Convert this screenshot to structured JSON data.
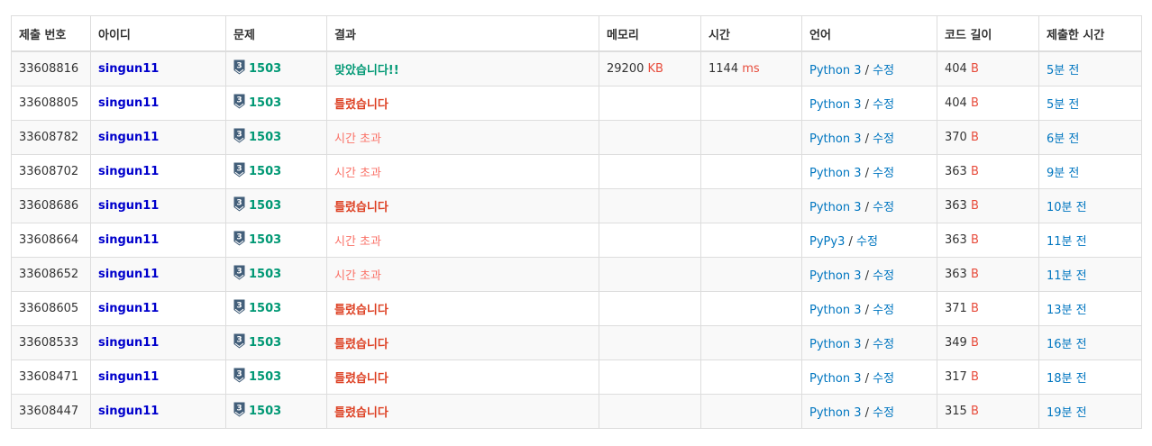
{
  "headers": [
    "제출 번호",
    "아이디",
    "문제",
    "결과",
    "메모리",
    "시간",
    "언어",
    "코드 길이",
    "제출한 시간"
  ],
  "units": {
    "memory": "KB",
    "time": "ms",
    "code_length": "B"
  },
  "edit_label": "수정",
  "tier_badge_label": "3",
  "colors": {
    "accepted": "#009874",
    "wrong_answer": "#dd4124",
    "time_limit": "#fa7268",
    "user": "#0000cc",
    "link": "#0076c0",
    "unit": "#e74c3c"
  },
  "rows": [
    {
      "id": "33608816",
      "user": "singun11",
      "problem": "1503",
      "result": "맞았습니다!!",
      "result_type": "ac",
      "memory": "29200",
      "time": "1144",
      "language": "Python 3",
      "code_length": "404",
      "submitted": "5분 전"
    },
    {
      "id": "33608805",
      "user": "singun11",
      "problem": "1503",
      "result": "틀렸습니다",
      "result_type": "wa",
      "memory": "",
      "time": "",
      "language": "Python 3",
      "code_length": "404",
      "submitted": "5분 전"
    },
    {
      "id": "33608782",
      "user": "singun11",
      "problem": "1503",
      "result": "시간 초과",
      "result_type": "tle",
      "memory": "",
      "time": "",
      "language": "Python 3",
      "code_length": "370",
      "submitted": "6분 전"
    },
    {
      "id": "33608702",
      "user": "singun11",
      "problem": "1503",
      "result": "시간 초과",
      "result_type": "tle",
      "memory": "",
      "time": "",
      "language": "Python 3",
      "code_length": "363",
      "submitted": "9분 전"
    },
    {
      "id": "33608686",
      "user": "singun11",
      "problem": "1503",
      "result": "틀렸습니다",
      "result_type": "wa",
      "memory": "",
      "time": "",
      "language": "Python 3",
      "code_length": "363",
      "submitted": "10분 전"
    },
    {
      "id": "33608664",
      "user": "singun11",
      "problem": "1503",
      "result": "시간 초과",
      "result_type": "tle",
      "memory": "",
      "time": "",
      "language": "PyPy3",
      "code_length": "363",
      "submitted": "11분 전"
    },
    {
      "id": "33608652",
      "user": "singun11",
      "problem": "1503",
      "result": "시간 초과",
      "result_type": "tle",
      "memory": "",
      "time": "",
      "language": "Python 3",
      "code_length": "363",
      "submitted": "11분 전"
    },
    {
      "id": "33608605",
      "user": "singun11",
      "problem": "1503",
      "result": "틀렸습니다",
      "result_type": "wa",
      "memory": "",
      "time": "",
      "language": "Python 3",
      "code_length": "371",
      "submitted": "13분 전"
    },
    {
      "id": "33608533",
      "user": "singun11",
      "problem": "1503",
      "result": "틀렸습니다",
      "result_type": "wa",
      "memory": "",
      "time": "",
      "language": "Python 3",
      "code_length": "349",
      "submitted": "16분 전"
    },
    {
      "id": "33608471",
      "user": "singun11",
      "problem": "1503",
      "result": "틀렸습니다",
      "result_type": "wa",
      "memory": "",
      "time": "",
      "language": "Python 3",
      "code_length": "317",
      "submitted": "18분 전"
    },
    {
      "id": "33608447",
      "user": "singun11",
      "problem": "1503",
      "result": "틀렸습니다",
      "result_type": "wa",
      "memory": "",
      "time": "",
      "language": "Python 3",
      "code_length": "315",
      "submitted": "19분 전"
    }
  ]
}
